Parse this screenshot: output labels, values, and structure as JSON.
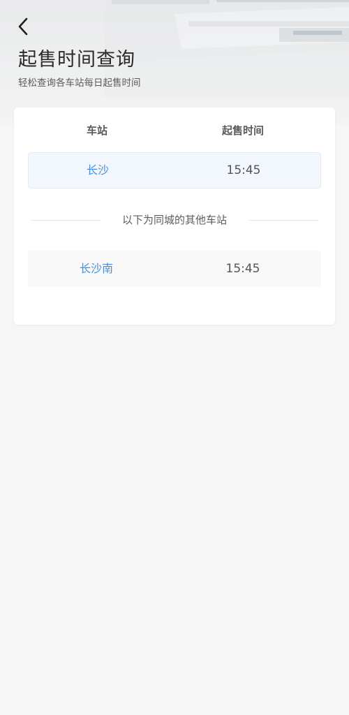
{
  "header": {
    "title": "起售时间查询",
    "subtitle": "轻松查询各车站每日起售时间"
  },
  "table": {
    "col_station": "车站",
    "col_time": "起售时间",
    "primary_row": {
      "station": "长沙",
      "time": "15:45"
    },
    "divider_text": "以下为同城的其他车站",
    "other_rows": [
      {
        "station": "长沙南",
        "time": "15:45"
      }
    ]
  },
  "colors": {
    "link_blue": "#4a8fd6",
    "primary_row_bg": "#f2f6fd",
    "page_bg": "#f6f6f7"
  }
}
